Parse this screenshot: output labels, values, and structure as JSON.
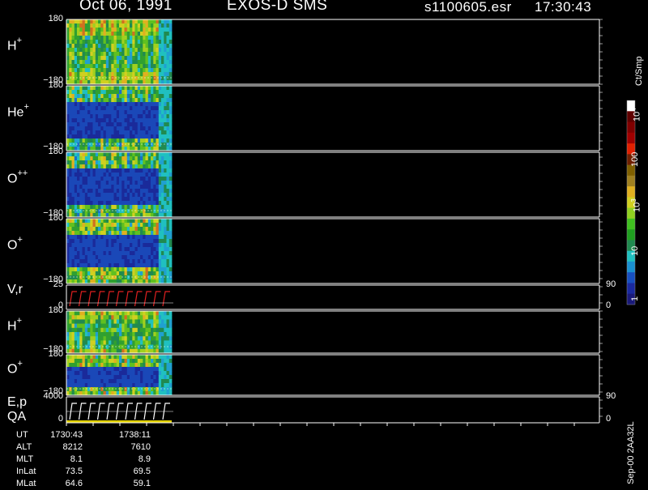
{
  "header": {
    "date": "Oct 06, 1991",
    "title": "EXOS-D SMS",
    "file": "s1100605.esr",
    "time": "17:30:43"
  },
  "panels": [
    {
      "label": "H",
      "charge": "+",
      "ytop": "180",
      "ybot": "−180"
    },
    {
      "label": "He",
      "charge": "+",
      "ytop": "180",
      "ybot": "−180"
    },
    {
      "label": "O",
      "charge": "++",
      "ytop": "180",
      "ybot": "−180"
    },
    {
      "label": "O",
      "charge": "+",
      "ytop": "180",
      "ybot": "−180"
    },
    {
      "label": "V,r",
      "charge": "",
      "ytop": "25",
      "ybot": "0",
      "rtop": "90",
      "rbot": "0"
    },
    {
      "label": "H",
      "charge": "+",
      "ytop": "180",
      "ybot": "−180"
    },
    {
      "label": "O",
      "charge": "+",
      "ytop": "180",
      "ybot": "−180"
    },
    {
      "label": "E,p",
      "label2": "QA",
      "charge": "",
      "ytop": "4000",
      "ybot": "0",
      "rtop": "90",
      "rbot": "0"
    }
  ],
  "info": {
    "rows": [
      {
        "label": "UT",
        "v1": "1730:43",
        "v2": "1738:11"
      },
      {
        "label": "ALT",
        "v1": "8212",
        "v2": "7610"
      },
      {
        "label": "MLT",
        "v1": "8.1",
        "v2": "8.9"
      },
      {
        "label": "InLat",
        "v1": "73.5",
        "v2": "69.5"
      },
      {
        "label": "MLat",
        "v1": "64.6",
        "v2": "59.1"
      }
    ]
  },
  "colorbar": {
    "units": "Ct/Smp",
    "labels": [
      "10",
      "100",
      "10",
      "10",
      "1"
    ],
    "label_exps": [
      "4",
      "",
      "3",
      "",
      ""
    ],
    "colors": [
      "#1a1a7a",
      "#1a2aa0",
      "#1850c0",
      "#1a90d0",
      "#20c0c0",
      "#208a50",
      "#20a020",
      "#40c020",
      "#90d020",
      "#d0d020",
      "#e0b020",
      "#a08020",
      "#806000",
      "#702000",
      "#e02000",
      "#a00000",
      "#800000",
      "#600000",
      "#ffffff"
    ]
  },
  "side_label": "Sep-00 2AA32L",
  "chart_data": {
    "type": "heatmap",
    "x_range": [
      "1730:43",
      "1738:11"
    ],
    "series": [
      {
        "name": "H+",
        "y_range": [
          -180,
          180
        ]
      },
      {
        "name": "He+",
        "y_range": [
          -180,
          180
        ]
      },
      {
        "name": "O++",
        "y_range": [
          -180,
          180
        ]
      },
      {
        "name": "O+",
        "y_range": [
          -180,
          180
        ]
      },
      {
        "name": "V,r",
        "y_range": [
          0,
          25
        ],
        "right_range": [
          0,
          90
        ]
      },
      {
        "name": "H+",
        "y_range": [
          -180,
          180
        ]
      },
      {
        "name": "O+",
        "y_range": [
          -180,
          180
        ]
      },
      {
        "name": "E,p QA",
        "y_range": [
          0,
          4000
        ],
        "right_range": [
          0,
          90
        ]
      }
    ],
    "colorbar_scale": "log",
    "colorbar_range": [
      1,
      10000
    ]
  }
}
